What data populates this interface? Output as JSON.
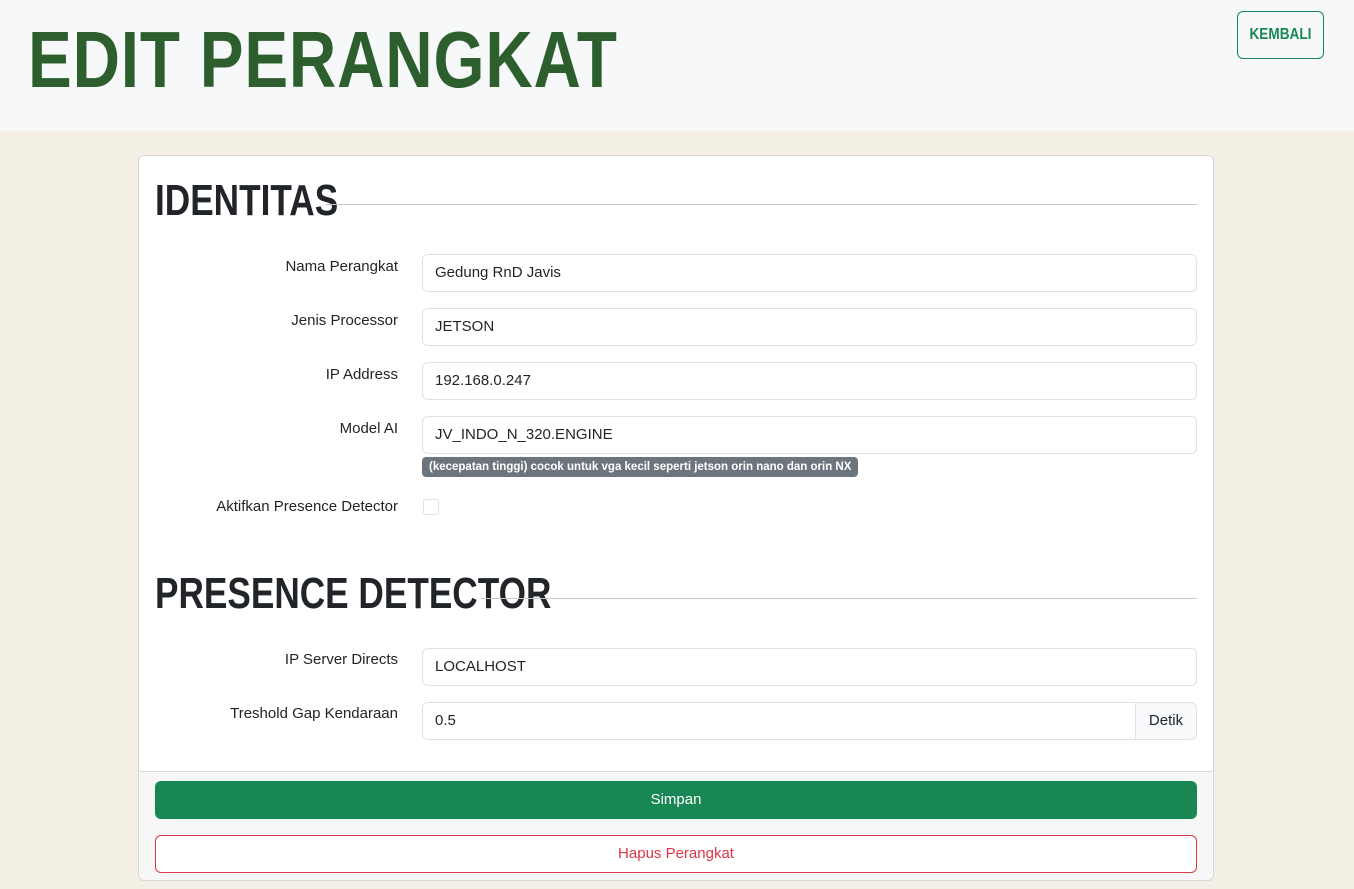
{
  "header": {
    "title": "EDIT PERANGKAT",
    "back_label": "KEMBALI"
  },
  "identitas": {
    "title": "IDENTITAS",
    "fields": {
      "nama": {
        "label": "Nama Perangkat",
        "value": "Gedung RnD Javis"
      },
      "processor": {
        "label": "Jenis Processor",
        "value": "JETSON"
      },
      "ip": {
        "label": "IP Address",
        "value": "192.168.0.247"
      },
      "model": {
        "label": "Model AI",
        "value": "JV_INDO_N_320.ENGINE",
        "help": "(kecepatan tinggi) cocok untuk vga kecil seperti jetson orin nano dan orin NX"
      },
      "presence": {
        "label": "Aktifkan Presence Detector",
        "checked": false
      }
    }
  },
  "presence_detector": {
    "title": "PRESENCE DETECTOR",
    "fields": {
      "ip_server": {
        "label": "IP Server Directs",
        "value": "LOCALHOST"
      },
      "threshold": {
        "label": "Treshold Gap Kendaraan",
        "value": "0.5",
        "unit": "Detik"
      }
    }
  },
  "footer": {
    "save_label": "Simpan",
    "delete_label": "Hapus Perangkat"
  },
  "colors": {
    "title": "#2c5e2e",
    "primary": "#198754",
    "danger": "#dc3545",
    "background": "#f4efe4"
  }
}
